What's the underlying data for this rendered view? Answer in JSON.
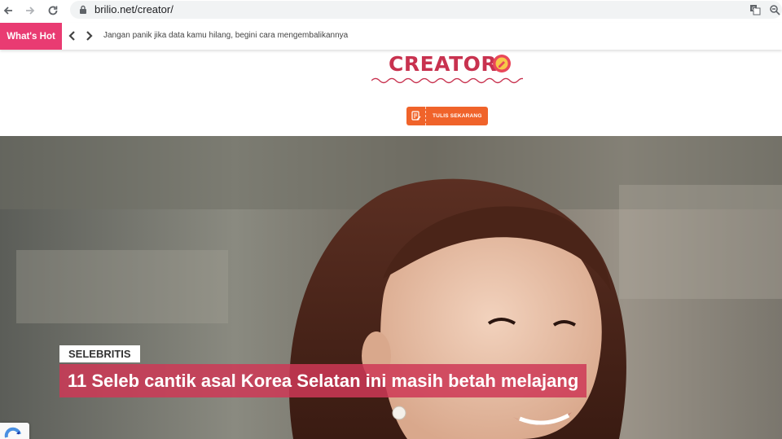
{
  "browser": {
    "url": "brilio.net/creator/",
    "back_icon": "back-arrow-icon",
    "forward_icon": "forward-arrow-icon",
    "reload_icon": "reload-icon",
    "lock_icon": "lock-icon",
    "translate_icon": "translate-icon",
    "zoom_icon": "zoom-icon"
  },
  "whats_hot": {
    "label": "What's Hot",
    "headline": "Jangan panik jika data kamu hilang, begini cara mengembalikannya"
  },
  "creator": {
    "title": "CREATOR",
    "write_button": "TULIS SEKARANG"
  },
  "hero": {
    "category": "SELEBRITIS",
    "headline": "11 Seleb cantik asal Korea Selatan ini masih betah melajang"
  },
  "colors": {
    "brand_pink": "#e93b72",
    "creator_red": "#c8324f",
    "button_orange": "#f0632a"
  }
}
